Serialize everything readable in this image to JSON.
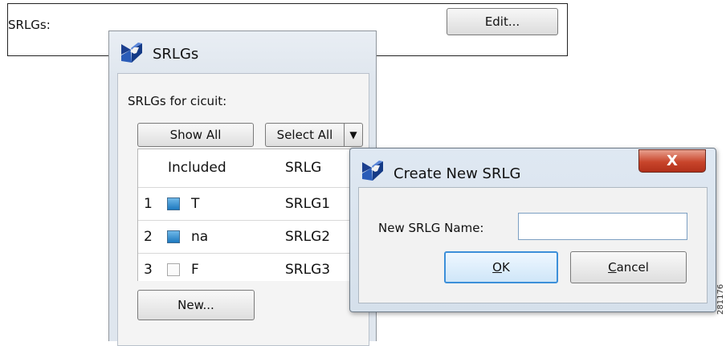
{
  "background": {
    "label": "SRLGs:",
    "edit_button": "Edit..."
  },
  "srlgs_window": {
    "title": "SRLGs",
    "for_label": "SRLGs for cicuit:",
    "show_all_button": "Show All",
    "select_all_button": "Select All",
    "columns": [
      "Included",
      "SRLG"
    ],
    "rows": [
      {
        "index": "1",
        "checked": true,
        "included": "T",
        "srlg": "SRLG1"
      },
      {
        "index": "2",
        "checked": true,
        "included": "na",
        "srlg": "SRLG2"
      },
      {
        "index": "3",
        "checked": false,
        "included": "F",
        "srlg": "SRLG3"
      }
    ],
    "new_button": "New..."
  },
  "create_dialog": {
    "title": "Create New SRLG",
    "name_label": "New SRLG Name:",
    "name_value": "",
    "ok_mnemonic": "O",
    "ok_rest": "K",
    "cancel_mnemonic": "C",
    "cancel_rest": "ancel",
    "close_glyph": "X"
  },
  "watermark": "281176",
  "icons": [
    "app-logo-icon",
    "dropdown-arrow-icon",
    "checkbox-icon",
    "close-icon"
  ],
  "colors": {
    "checkbox_fill": "#1d79bf",
    "close_button": "#c8452b",
    "ok_focus": "#3c8fd9"
  }
}
